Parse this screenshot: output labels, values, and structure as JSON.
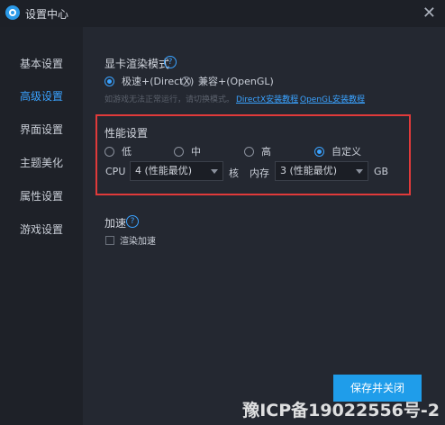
{
  "window": {
    "title": "设置中心",
    "close_glyph": "✕"
  },
  "sidebar": {
    "items": [
      {
        "label": "基本设置",
        "active": false
      },
      {
        "label": "高级设置",
        "active": true
      },
      {
        "label": "界面设置",
        "active": false
      },
      {
        "label": "主题美化",
        "active": false
      },
      {
        "label": "属性设置",
        "active": false
      },
      {
        "label": "游戏设置",
        "active": false
      }
    ]
  },
  "render_mode": {
    "title": "显卡渲染模式",
    "help_glyph": "?",
    "options": [
      "极速+(DirectX)",
      "兼容+(OpenGL)"
    ],
    "selected": "极速+(DirectX)",
    "hint": "如游戏无法正常运行，请切换模式。",
    "links": [
      "DirectX安装教程",
      "OpenGL安装教程"
    ]
  },
  "performance": {
    "title": "性能设置",
    "options": [
      "低",
      "中",
      "高",
      "自定义"
    ],
    "selected": "自定义",
    "cpu_label": "CPU",
    "cpu_value": "4 (性能最优)",
    "cpu_unit": "核",
    "memory_label": "内存",
    "memory_value": "3 (性能最优)",
    "memory_unit": "GB"
  },
  "accelerate": {
    "title": "加速",
    "help_glyph": "?",
    "checkbox_label": "渲染加速",
    "checked": false
  },
  "footer": {
    "save_button": "保存并关闭"
  },
  "watermark": "豫ICP备19022556号-2",
  "colors": {
    "accent": "#3aa2ff",
    "highlight_box": "#e03a3a",
    "button": "#1f9dea"
  }
}
